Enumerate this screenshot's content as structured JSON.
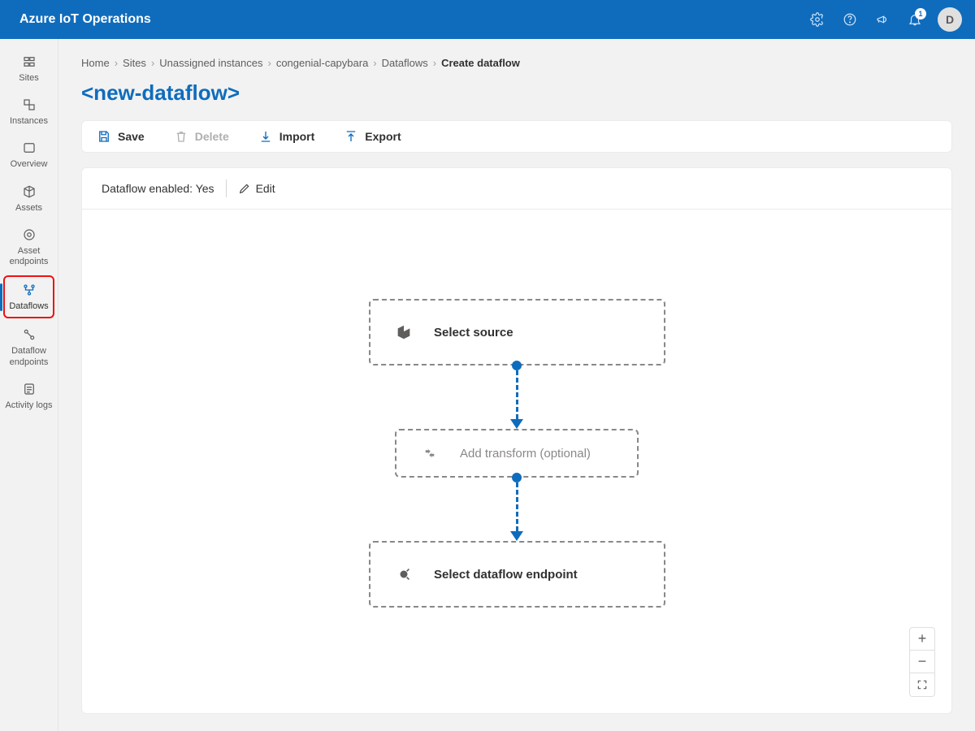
{
  "header": {
    "product_name": "Azure IoT Operations",
    "notification_count": "1",
    "avatar_initial": "D"
  },
  "sidebar": {
    "items": [
      {
        "name": "sites",
        "label": "Sites"
      },
      {
        "name": "instances",
        "label": "Instances"
      },
      {
        "name": "overview",
        "label": "Overview"
      },
      {
        "name": "assets",
        "label": "Assets"
      },
      {
        "name": "asset-endpoints",
        "label": "Asset endpoints"
      },
      {
        "name": "dataflows",
        "label": "Dataflows",
        "selected": true
      },
      {
        "name": "dataflow-endpoints",
        "label": "Dataflow endpoints"
      },
      {
        "name": "activity-logs",
        "label": "Activity logs"
      }
    ]
  },
  "breadcrumbs": [
    "Home",
    "Sites",
    "Unassigned instances",
    "congenial-capybara",
    "Dataflows",
    "Create dataflow"
  ],
  "page_title": "<new-dataflow>",
  "toolbar": {
    "save": "Save",
    "delete": "Delete",
    "import": "Import",
    "export": "Export"
  },
  "enabled_bar": {
    "label": "Dataflow enabled: Yes",
    "edit": "Edit"
  },
  "nodes": {
    "source": "Select source",
    "transform": "Add transform (optional)",
    "endpoint": "Select dataflow endpoint"
  }
}
